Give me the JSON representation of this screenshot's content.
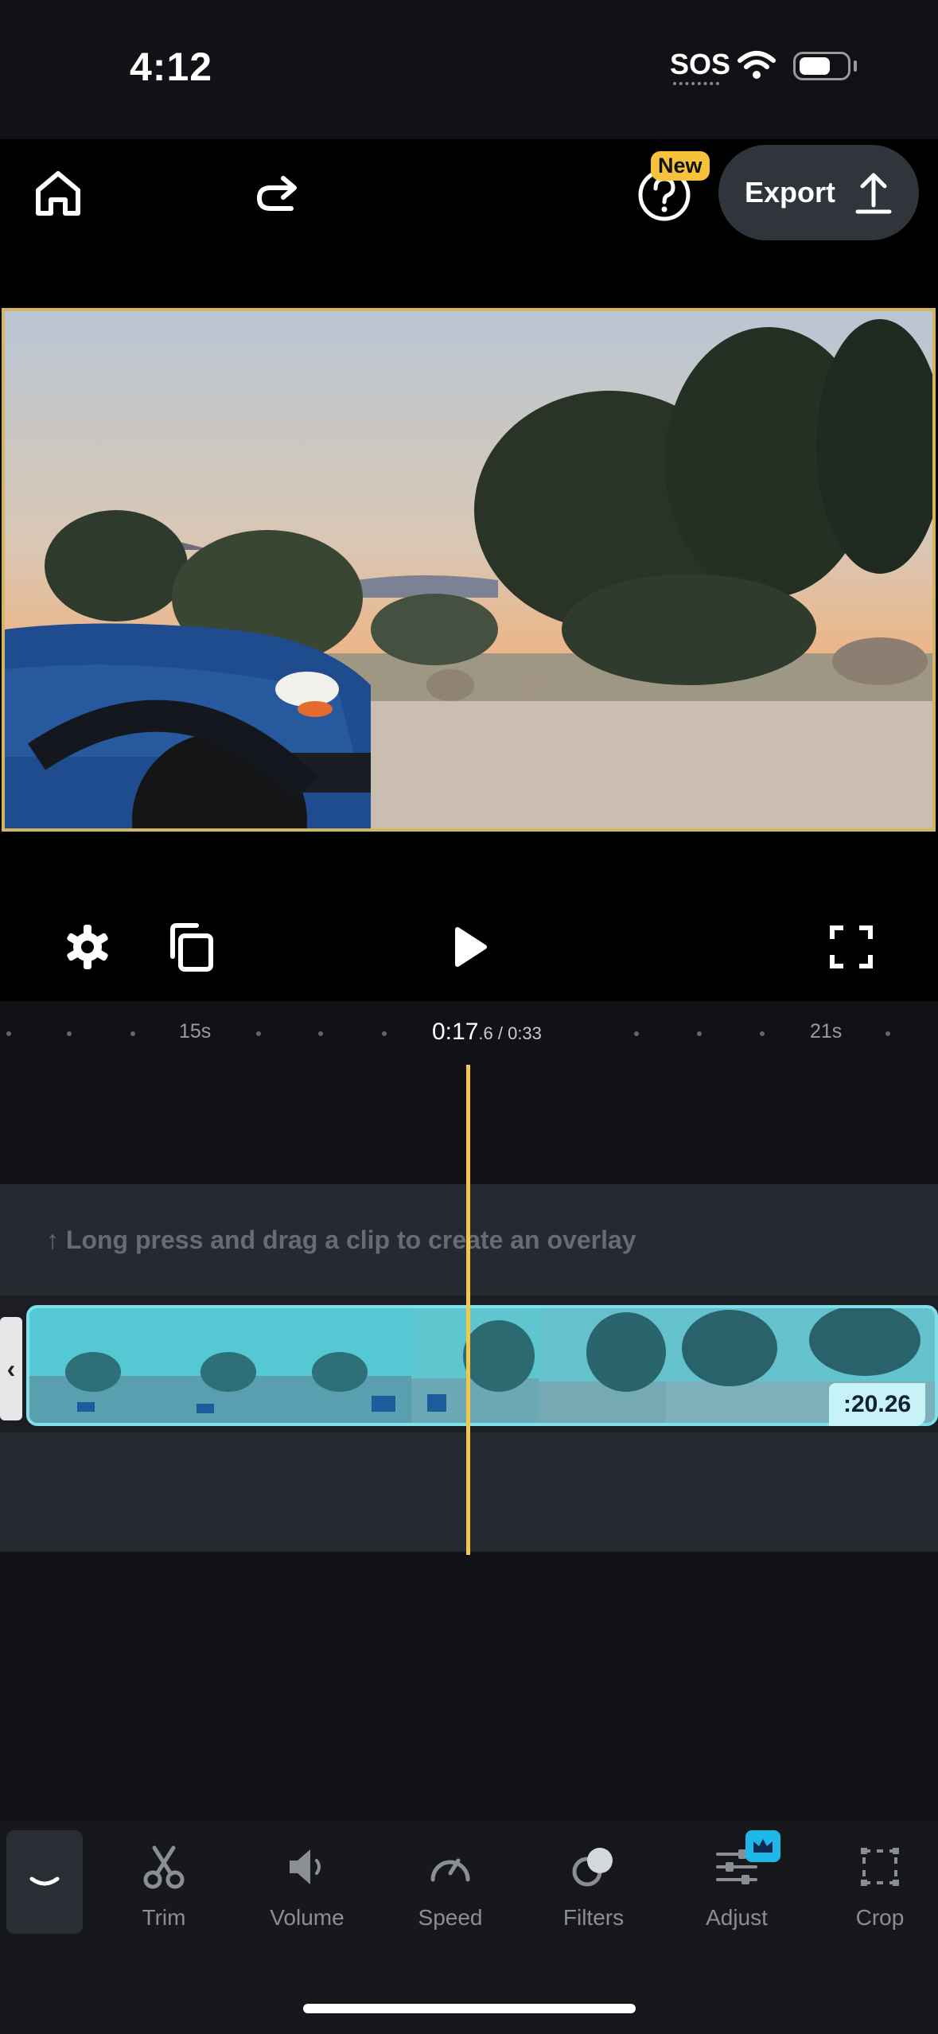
{
  "status_bar": {
    "time": "4:12",
    "sos": "SOS"
  },
  "toolbar": {
    "new_badge": "New",
    "export_label": "Export"
  },
  "timeline": {
    "ruler_labels": [
      "15s",
      "21s"
    ],
    "current_time": "0:17",
    "current_time_fraction": ".6",
    "total_time": " / 0:33",
    "overlay_hint": "↑ Long press and drag a clip to create an overlay",
    "clip_duration": ":20.26"
  },
  "tools": [
    {
      "label": "Trim",
      "icon": "scissors-icon"
    },
    {
      "label": "Volume",
      "icon": "speaker-icon"
    },
    {
      "label": "Speed",
      "icon": "speedometer-icon"
    },
    {
      "label": "Filters",
      "icon": "filters-icon"
    },
    {
      "label": "Adjust",
      "icon": "sliders-icon"
    },
    {
      "label": "Crop",
      "icon": "crop-icon"
    }
  ],
  "colors": {
    "accent_yellow": "#f4c64a",
    "clip_cyan": "#4dc4cf",
    "badge_blue": "#1fb6e8",
    "new_badge": "#f6c23a"
  }
}
